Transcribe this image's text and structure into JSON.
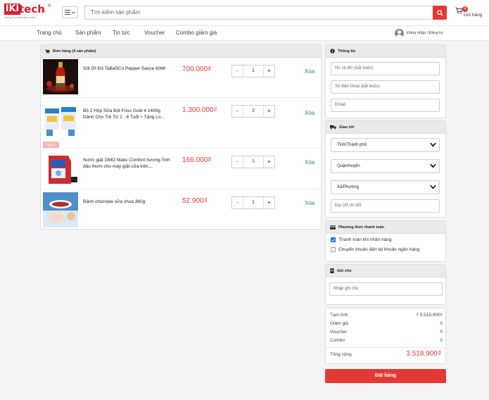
{
  "header": {
    "logo_mark": "iKi",
    "logo_text": "tech",
    "logo_reg": "®",
    "logo_tagline": "Adding Your Business Online",
    "search_placeholder": "Tìm kiếm sản phẩm",
    "cart_count": "4",
    "cart_label": "Giỏ hàng"
  },
  "nav": {
    "items": [
      "Trang chủ",
      "Sản phẩm",
      "Tin tức",
      "Voucher",
      "Combo giảm giá"
    ],
    "login_label": "Đăng nhập / Đăng ký"
  },
  "cart": {
    "title": "Đơn hàng (4 sản phẩm)",
    "remove_label": "Xóa",
    "items": [
      {
        "name": "Sốt Ớt Đỏ TaBaSCo Pepper Sauce 60Ml",
        "price": "700.000₫",
        "qty": "1",
        "minus": "-",
        "plus": "+"
      },
      {
        "name": "Bộ 2 Hộp Sữa Bột Friso Gold 4 1400g Dành Cho Trẻ Từ 2 - 6 Tuổi + Tặng Lo...",
        "price": "1.300.000₫",
        "qty": "2",
        "minus": "-",
        "plus": "+",
        "tag": "Giao 1"
      },
      {
        "name": "Nước giặt OMO Matic Comfort hương Tinh dầu thơm cho máy giặt cửa trên,...",
        "price": "166.000₫",
        "qty": "1",
        "minus": "-",
        "plus": "+"
      },
      {
        "name": "Bánh chocopie sữa chua 360g",
        "price": "52.900₫",
        "qty": "1",
        "minus": "-",
        "plus": "+"
      }
    ]
  },
  "info": {
    "title": "Thông tin",
    "name_placeholder": "Họ và tên (bắt buộc)",
    "phone_placeholder": "Số điện thoại (bắt buộc)",
    "email_placeholder": "Email"
  },
  "shipping": {
    "title": "Giao tới",
    "province": "Tỉnh/Thành phố",
    "district": "Quận/huyện",
    "ward": "Xã/Phường",
    "address_placeholder": "Địa chỉ chi tiết"
  },
  "payment": {
    "title": "Phương thức thanh toán",
    "options": [
      {
        "label": "Thanh toán khi nhận hàng",
        "checked": true
      },
      {
        "label": "Chuyển khoản đến tài khoản ngân hàng",
        "checked": false
      }
    ]
  },
  "note": {
    "title": "Ghi chú",
    "placeholder": "Nhập ghi chú"
  },
  "summary": {
    "subtotal_label": "Tạm tính",
    "subtotal": "₫ 3.518.900₫",
    "discount_label": "Giảm giá",
    "discount": "0",
    "voucher_label": "Voucher",
    "voucher": "0",
    "combo_label": "Combo",
    "combo": "0",
    "total_label": "Tổng cộng",
    "total": "3.518.900₫"
  },
  "order_button": "Đặt hàng",
  "colors": {
    "accent": "#e53935",
    "remove": "#2e8b57",
    "brand": "#d3202a"
  }
}
